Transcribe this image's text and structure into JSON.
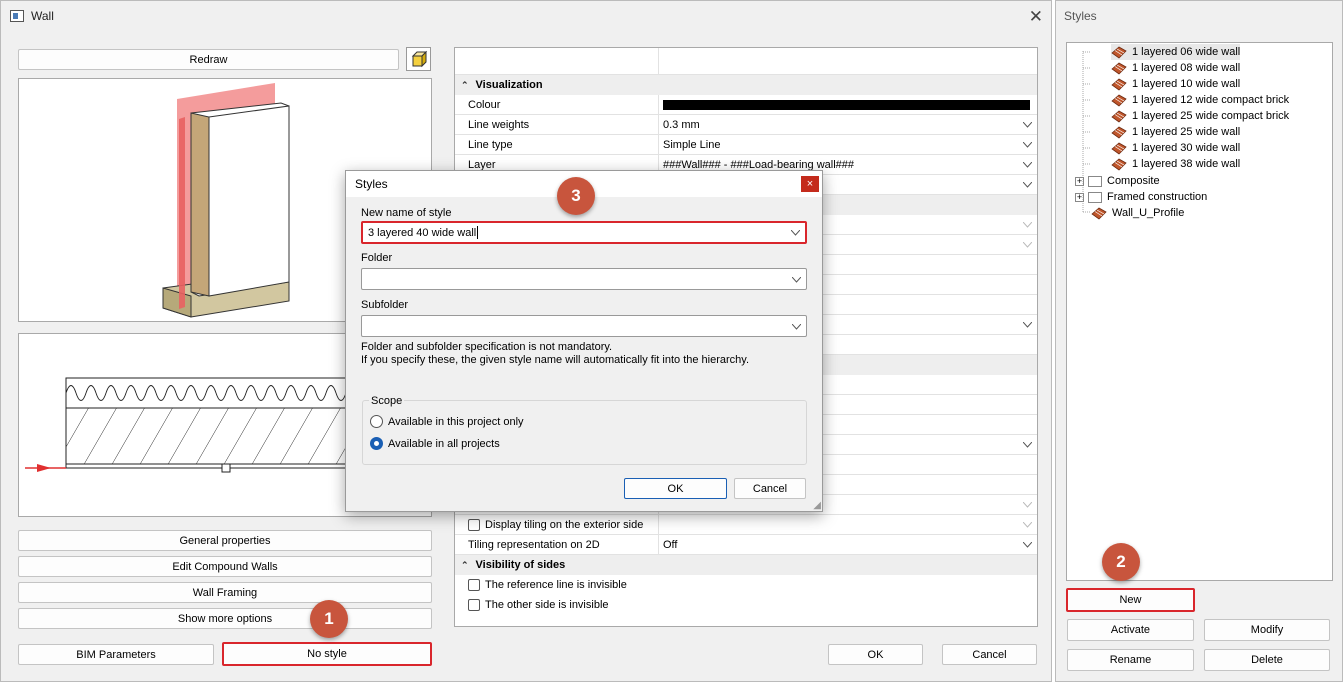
{
  "main_window": {
    "title": "Wall",
    "redraw_label": "Redraw",
    "buttons": {
      "general_properties": "General properties",
      "edit_compound_walls": "Edit Compound Walls",
      "wall_framing": "Wall Framing",
      "show_more_options": "Show more options",
      "bim_parameters": "BIM Parameters",
      "no_style": "No style",
      "ok": "OK",
      "cancel": "Cancel"
    }
  },
  "properties": {
    "visualization_header": "Visualization",
    "colour_label": "Colour",
    "colour_value": "#000000",
    "line_weights_label": "Line weights",
    "line_weights_value": "0.3 mm",
    "line_type_label": "Line type",
    "line_type_value": "Simple Line",
    "layer_label": "Layer",
    "layer_value": "###Wall### - ###Load-bearing wall###",
    "display_tiling_label": "Display tiling on the exterior side",
    "tiling_rep_label": "Tiling representation on 2D",
    "tiling_rep_value": "Off",
    "visibility_header": "Visibility of sides",
    "ref_line_invisible_label": "The reference line is invisible",
    "other_side_invisible_label": "The other side is invisible"
  },
  "styles_panel": {
    "title": "Styles",
    "items": [
      "1 layered 06 wide wall",
      "1 layered 08 wide wall",
      "1 layered 10 wide wall",
      "1 layered 12 wide compact brick",
      "1 layered 25 wide compact brick",
      "1 layered 25 wide wall",
      "1 layered 30 wide wall",
      "1 layered 38 wide wall"
    ],
    "folders": [
      "Composite",
      "Framed construction"
    ],
    "profile_item": "Wall_U_Profile",
    "buttons": {
      "new": "New",
      "activate": "Activate",
      "modify": "Modify",
      "rename": "Rename",
      "delete": "Delete"
    }
  },
  "dialog": {
    "title": "Styles",
    "close": "×",
    "new_name_label": "New name of style",
    "new_name_value": "3 layered 40 wide wall",
    "folder_label": "Folder",
    "folder_value": "",
    "subfolder_label": "Subfolder",
    "subfolder_value": "",
    "info_line1": "Folder and subfolder specification is not mandatory.",
    "info_line2": "If you specify these, the given style name will automatically fit into the hierarchy.",
    "scope_label": "Scope",
    "scope_option1": "Available in this project only",
    "scope_option2": "Available in all projects",
    "ok": "OK",
    "cancel": "Cancel"
  },
  "badges": {
    "one": "1",
    "two": "2",
    "three": "3"
  },
  "colors": {
    "highlight_red": "#d9262c",
    "badge": "#c8553d",
    "accent_blue": "#1a5fb4"
  }
}
